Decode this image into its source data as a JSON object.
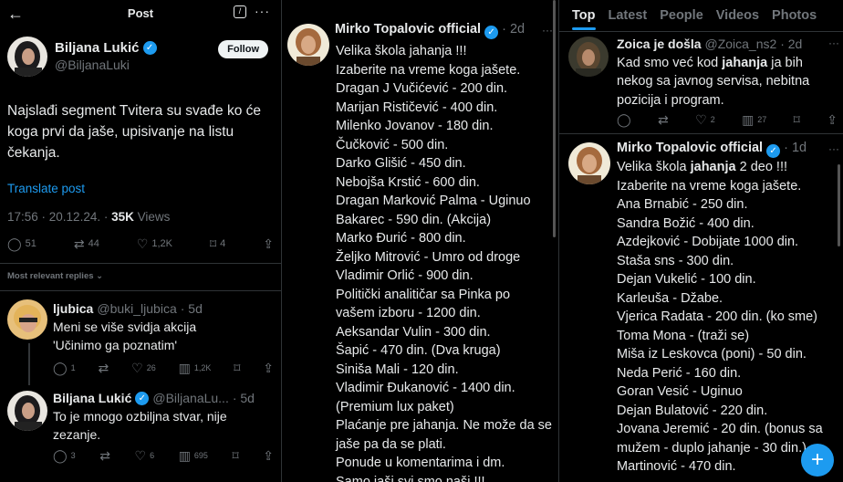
{
  "post_panel": {
    "title": "Post",
    "author": {
      "name": "Biljana Lukić",
      "handle": "@BiljanaLuki"
    },
    "follow_label": "Follow",
    "text": "Najslađi segment Tvitera su svađe ko će koga prvi da jaše, upisivanje na listu čekanja.",
    "translate": "Translate post",
    "time": "17:56 · 20.12.24. · ",
    "views_count": "35K",
    "views_label": " Views",
    "stats": {
      "replies": "51",
      "reposts": "44",
      "likes": "1,2K",
      "bookmarks": "4"
    },
    "relevant_label": "Most relevant replies ⌄",
    "replies": [
      {
        "name": "ljubica",
        "handle": "@buki_ljubica",
        "time": "· 5d",
        "text": "Meni se više svidja akcija 'Učinimo ga poznatim'",
        "stats": {
          "replies": "1",
          "reposts": "",
          "likes": "26",
          "views": "1,2K"
        }
      },
      {
        "name": "Biljana Lukić",
        "handle": "@BiljanaLu...",
        "time": "· 5d",
        "text": "To je mnogo ozbiljna stvar, nije zezanje.",
        "stats": {
          "replies": "3",
          "reposts": "",
          "likes": "6",
          "views": "695"
        }
      }
    ]
  },
  "middle_panel": {
    "name": "Mirko Topalovic official",
    "time": "· 2d",
    "lines": [
      "Velika škola jahanja !!!",
      "Izaberite na vreme koga jašete.",
      "Dragan J Vučićević - 200 din.",
      "Marijan Rističević - 400 din.",
      "Milenko Jovanov - 180 din.",
      "Čučković - 500 din.",
      "Darko Glišić - 450 din.",
      "Nebojša Krstić - 600 din.",
      "Dragan Marković Palma - Uginuo",
      "Bakarec - 590 din. (Akcija)",
      "Marko Đurić - 800 din.",
      "Željko Mitrović - Umro od droge",
      "Vladimir Orlić - 900 din.",
      "Politički analitičar sa Pinka po",
      "vašem izboru - 1200 din.",
      "Aeksandar Vulin - 300 din.",
      "Šapić - 470 din. (Dva kruga)",
      "Siniša Mali - 120 din.",
      "Vladimir Đukanović - 1400 din.",
      "(Premium lux paket)",
      "Plaćanje pre jahanja. Ne može da se",
      "jaše pa da se plati.",
      "Ponude u komentarima i dm.",
      "Samo jaši svi smo naši !!!"
    ]
  },
  "right_panel": {
    "tabs": [
      "Top",
      "Latest",
      "People",
      "Videos",
      "Photos"
    ],
    "tweet1": {
      "name": "Zoica je došla",
      "handle": "@Zoica_ns2",
      "time": "· 2d",
      "text_before": "Kad smo već kod ",
      "text_bold": "jahanja",
      "text_after": " ja bih nekog sa javnog servisa, nebitna pozicija i program.",
      "stats": {
        "replies": "",
        "reposts": "",
        "likes": "2",
        "views": "27"
      }
    },
    "tweet2": {
      "name": "Mirko Topalovic official",
      "time": "· 1d",
      "line1_before": "Velika škola ",
      "line1_bold": "jahanja",
      "line1_after": " 2 deo !!!",
      "lines": [
        "Izaberite na vreme koga jašete.",
        "Ana Brnabić - 250 din.",
        "Sandra Božić - 400 din.",
        "Azdejković - Dobijate 1000 din.",
        "Staša sns - 300 din.",
        "Dejan Vukelić - 100 din.",
        "Karleuša - Džabe.",
        "Vjerica Radata - 200 din. (ko sme)",
        "Toma Mona - (traži se)",
        "Miša iz Leskovca (poni) - 50 din.",
        "Neda Perić - 160 din.",
        "Goran Vesić - Uginuo",
        "Dejan Bulatović - 220 din.",
        "Jovana Jeremić - 20 din. (bonus sa",
        "mužem - duplo jahanje - 30 din.)",
        "Martinović - 470 din."
      ]
    },
    "fab_label": "+"
  }
}
